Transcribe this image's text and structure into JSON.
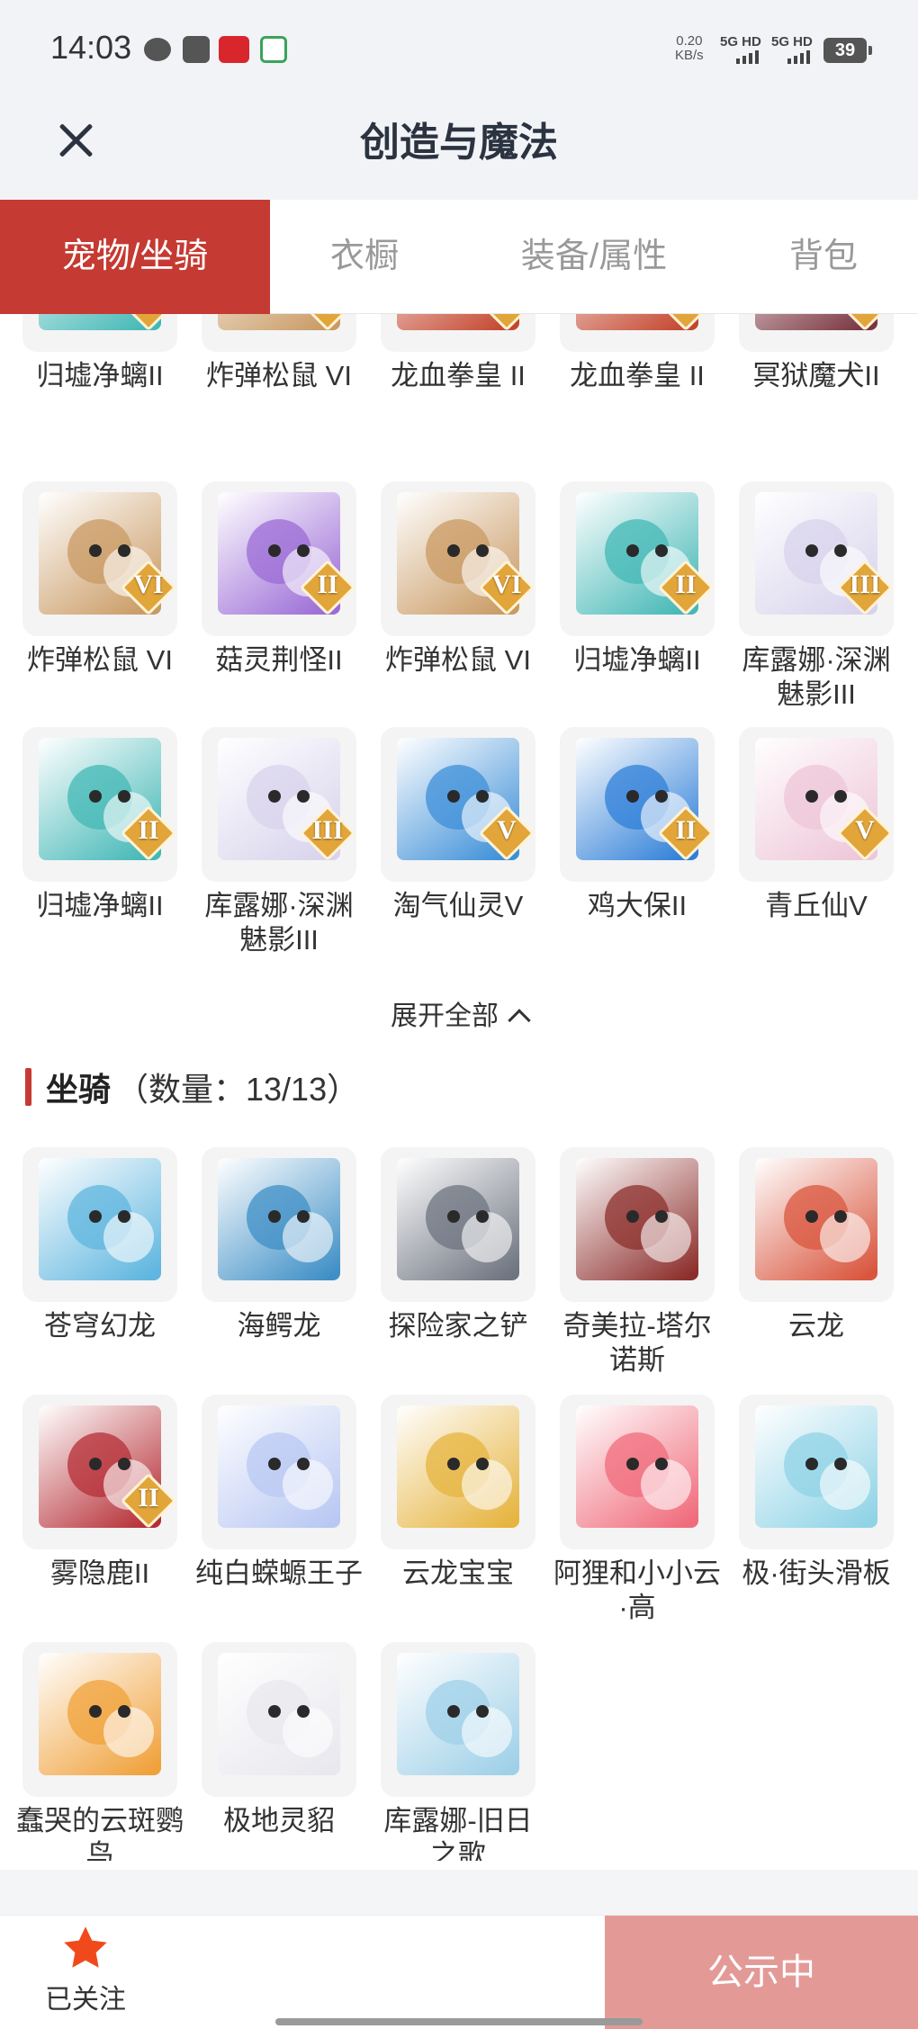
{
  "status_bar": {
    "time": "14:03",
    "speed_value": "0.20",
    "speed_unit": "KB/s",
    "signal_1": "5G HD",
    "signal_2": "5G HD",
    "battery": "39"
  },
  "header": {
    "title": "创造与魔法",
    "close_icon": "close-icon"
  },
  "tabs": [
    {
      "label": "宠物/坐骑",
      "active": true
    },
    {
      "label": "衣橱",
      "active": false
    },
    {
      "label": "装备/属性",
      "active": false
    },
    {
      "label": "背包",
      "active": false
    }
  ],
  "pets": [
    {
      "name": "归墟净螭II",
      "badge": "II",
      "color": "#43b8b6"
    },
    {
      "name": "炸弹松鼠 VI",
      "badge": "VI",
      "color": "#c99a63"
    },
    {
      "name": "龙血拳皇 II",
      "badge": "II",
      "color": "#c4462e"
    },
    {
      "name": "龙血拳皇 II",
      "badge": "II",
      "color": "#c4462e"
    },
    {
      "name": "冥狱魔犬II",
      "badge": "II",
      "color": "#7a3540"
    },
    {
      "name": "炸弹松鼠 VI",
      "badge": "VI",
      "color": "#c99a63"
    },
    {
      "name": "菇灵荆怪II",
      "badge": "II",
      "color": "#9b6bd6"
    },
    {
      "name": "炸弹松鼠 VI",
      "badge": "VI",
      "color": "#c99a63"
    },
    {
      "name": "归墟净螭II",
      "badge": "II",
      "color": "#43b8b6"
    },
    {
      "name": "库露娜·深渊魅影III",
      "badge": "III",
      "color": "#d8d3ec"
    },
    {
      "name": "归墟净螭II",
      "badge": "II",
      "color": "#43b8b6"
    },
    {
      "name": "库露娜·深渊魅影III",
      "badge": "III",
      "color": "#d8d3ec"
    },
    {
      "name": "淘气仙灵V",
      "badge": "V",
      "color": "#3d8fd8"
    },
    {
      "name": "鸡大保II",
      "badge": "II",
      "color": "#2f7fd8"
    },
    {
      "name": "青丘仙V",
      "badge": "V",
      "color": "#eec6d8"
    }
  ],
  "expand": {
    "label": "展开全部"
  },
  "mounts_section": {
    "title": "坐骑",
    "count": "（数量：13/13）"
  },
  "mounts": [
    {
      "name": "苍穹幻龙",
      "badge": "",
      "color": "#5fb6df"
    },
    {
      "name": "海鳄龙",
      "badge": "",
      "color": "#3f8fc6"
    },
    {
      "name": "探险家之铲",
      "badge": "",
      "color": "#6e7480"
    },
    {
      "name": "奇美拉-塔尔诺斯",
      "badge": "",
      "color": "#8c2f2c"
    },
    {
      "name": "云龙",
      "badge": "",
      "color": "#d9553d"
    },
    {
      "name": "雾隐鹿II",
      "badge": "II",
      "color": "#b52e35"
    },
    {
      "name": "纯白蝾螈王子",
      "badge": "",
      "color": "#b9c8f3"
    },
    {
      "name": "云龙宝宝",
      "badge": "",
      "color": "#e6b43f"
    },
    {
      "name": "阿狸和小小云·高",
      "badge": "",
      "color": "#f06b7b"
    },
    {
      "name": "极·街头滑板",
      "badge": "",
      "color": "#8fd3e6"
    },
    {
      "name": "蠢哭的云斑鹦鸟",
      "badge": "",
      "color": "#f0a13a"
    },
    {
      "name": "极地灵貂",
      "badge": "",
      "color": "#e8e8ee"
    },
    {
      "name": "库露娜-旧日之歌",
      "badge": "",
      "color": "#9fd0e8"
    }
  ],
  "bottom_bar": {
    "follow_label": "已关注",
    "public_label": "公示中",
    "star_color": "#f04a1c"
  }
}
